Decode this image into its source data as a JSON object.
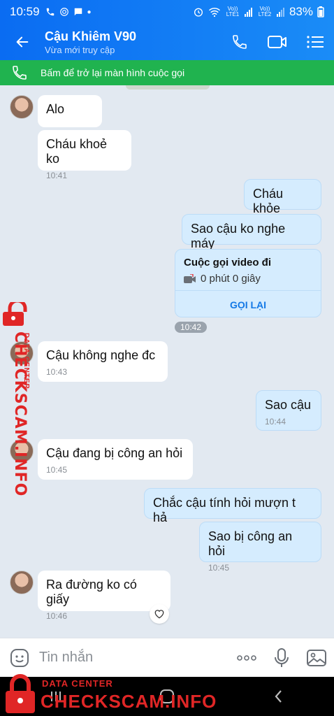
{
  "status": {
    "time": "10:59",
    "volte1": "Vo)) LTE1",
    "volte2": "Vo)) LTE2",
    "battery": "83%"
  },
  "header": {
    "name": "Cậu Khiêm V90",
    "subtitle": "Vừa mới truy cập"
  },
  "callbar": {
    "text": "Bấm để trở lại màn hình cuộc gọi"
  },
  "messages": {
    "m1": {
      "text": "Alo"
    },
    "m2": {
      "text": "Cháu khoẻ ko",
      "time": "10:41"
    },
    "m3": {
      "text": "Cháu khỏe"
    },
    "m4": {
      "text": "Sao cậu ko nghe máy"
    },
    "call": {
      "title": "Cuộc gọi video đi",
      "duration": "0 phút 0 giây",
      "button": "GỌI LẠI"
    },
    "chip": "10:42",
    "m5": {
      "text": "Cậu không nghe đc",
      "time": "10:43"
    },
    "m6": {
      "text": "Sao cậu",
      "time": "10:44"
    },
    "m7": {
      "text": "Cậu đang bị công an hỏi",
      "time": "10:45"
    },
    "m8": {
      "text": "Chắc cậu tính hỏi mượn t hả"
    },
    "m9": {
      "text": "Sao bị công an hỏi",
      "time": "10:45"
    },
    "m10": {
      "text": "Ra đường ko có giấy",
      "time": "10:46"
    }
  },
  "input": {
    "placeholder": "Tin nhắn"
  },
  "watermark": {
    "small": "DATA CENTER",
    "big": "CHECKSCAM.INFO"
  },
  "colors": {
    "header": "#0a6cf2",
    "callbar": "#20b34f",
    "outgoing": "#d5ecfe",
    "watermark": "#e02626"
  }
}
